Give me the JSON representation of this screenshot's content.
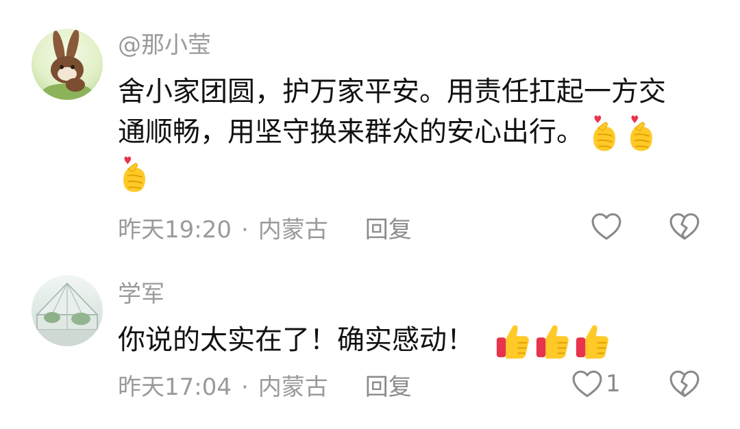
{
  "comments": [
    {
      "username": "@那小莹",
      "text_line1": "舍小家团圆，护万家平安。用责任扛起一方交",
      "text_line2": "通顺畅，用坚守换来群众的安心出行。",
      "emoji": "finger-heart",
      "emoji_count": 3,
      "time": "昨天19:20",
      "separator": "·",
      "location": "内蒙古",
      "reply_label": "回复",
      "like_count": ""
    },
    {
      "username": "学军",
      "text": "你说的太实在了！确实感动！",
      "emoji": "thumbs-up",
      "emoji_count": 3,
      "time": "昨天17:04",
      "separator": "·",
      "location": "内蒙古",
      "reply_label": "回复",
      "like_count": "1"
    }
  ],
  "icons": {
    "like": "heart-outline-icon",
    "dislike": "broken-heart-icon"
  },
  "colors": {
    "meta_text": "#9a9a9a",
    "icon_stroke": "#8a8a8a",
    "heart_red": "#e8334d",
    "emoji_yellow": "#ffc928"
  }
}
